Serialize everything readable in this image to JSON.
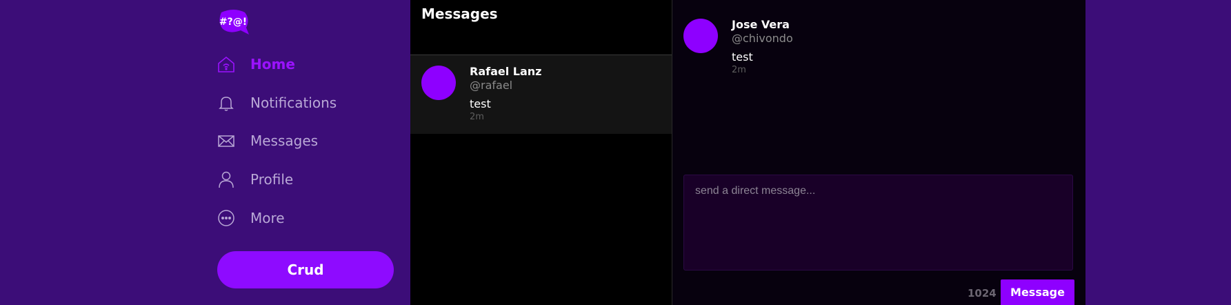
{
  "app": {
    "logo_text": "#?@!"
  },
  "sidebar": {
    "items": [
      {
        "label": "Home",
        "icon": "home-icon",
        "active": true
      },
      {
        "label": "Notifications",
        "icon": "bell-icon",
        "active": false
      },
      {
        "label": "Messages",
        "icon": "envelope-icon",
        "active": false
      },
      {
        "label": "Profile",
        "icon": "user-icon",
        "active": false
      },
      {
        "label": "More",
        "icon": "more-icon",
        "active": false
      }
    ],
    "crud_label": "Crud"
  },
  "messages": {
    "title": "Messages",
    "conversations": [
      {
        "name": "Rafael Lanz",
        "handle": "@rafael",
        "preview": "test",
        "time": "2m"
      }
    ]
  },
  "chat": {
    "messages": [
      {
        "name": "Jose Vera",
        "handle": "@chivondo",
        "text": "test",
        "time": "2m"
      }
    ],
    "compose": {
      "placeholder": "send a direct message...",
      "value": "",
      "counter": "1024",
      "send_label": "Message"
    }
  },
  "colors": {
    "accent": "#8e00ff",
    "background": "#3c0d78",
    "active_nav": "#9b12ff"
  }
}
